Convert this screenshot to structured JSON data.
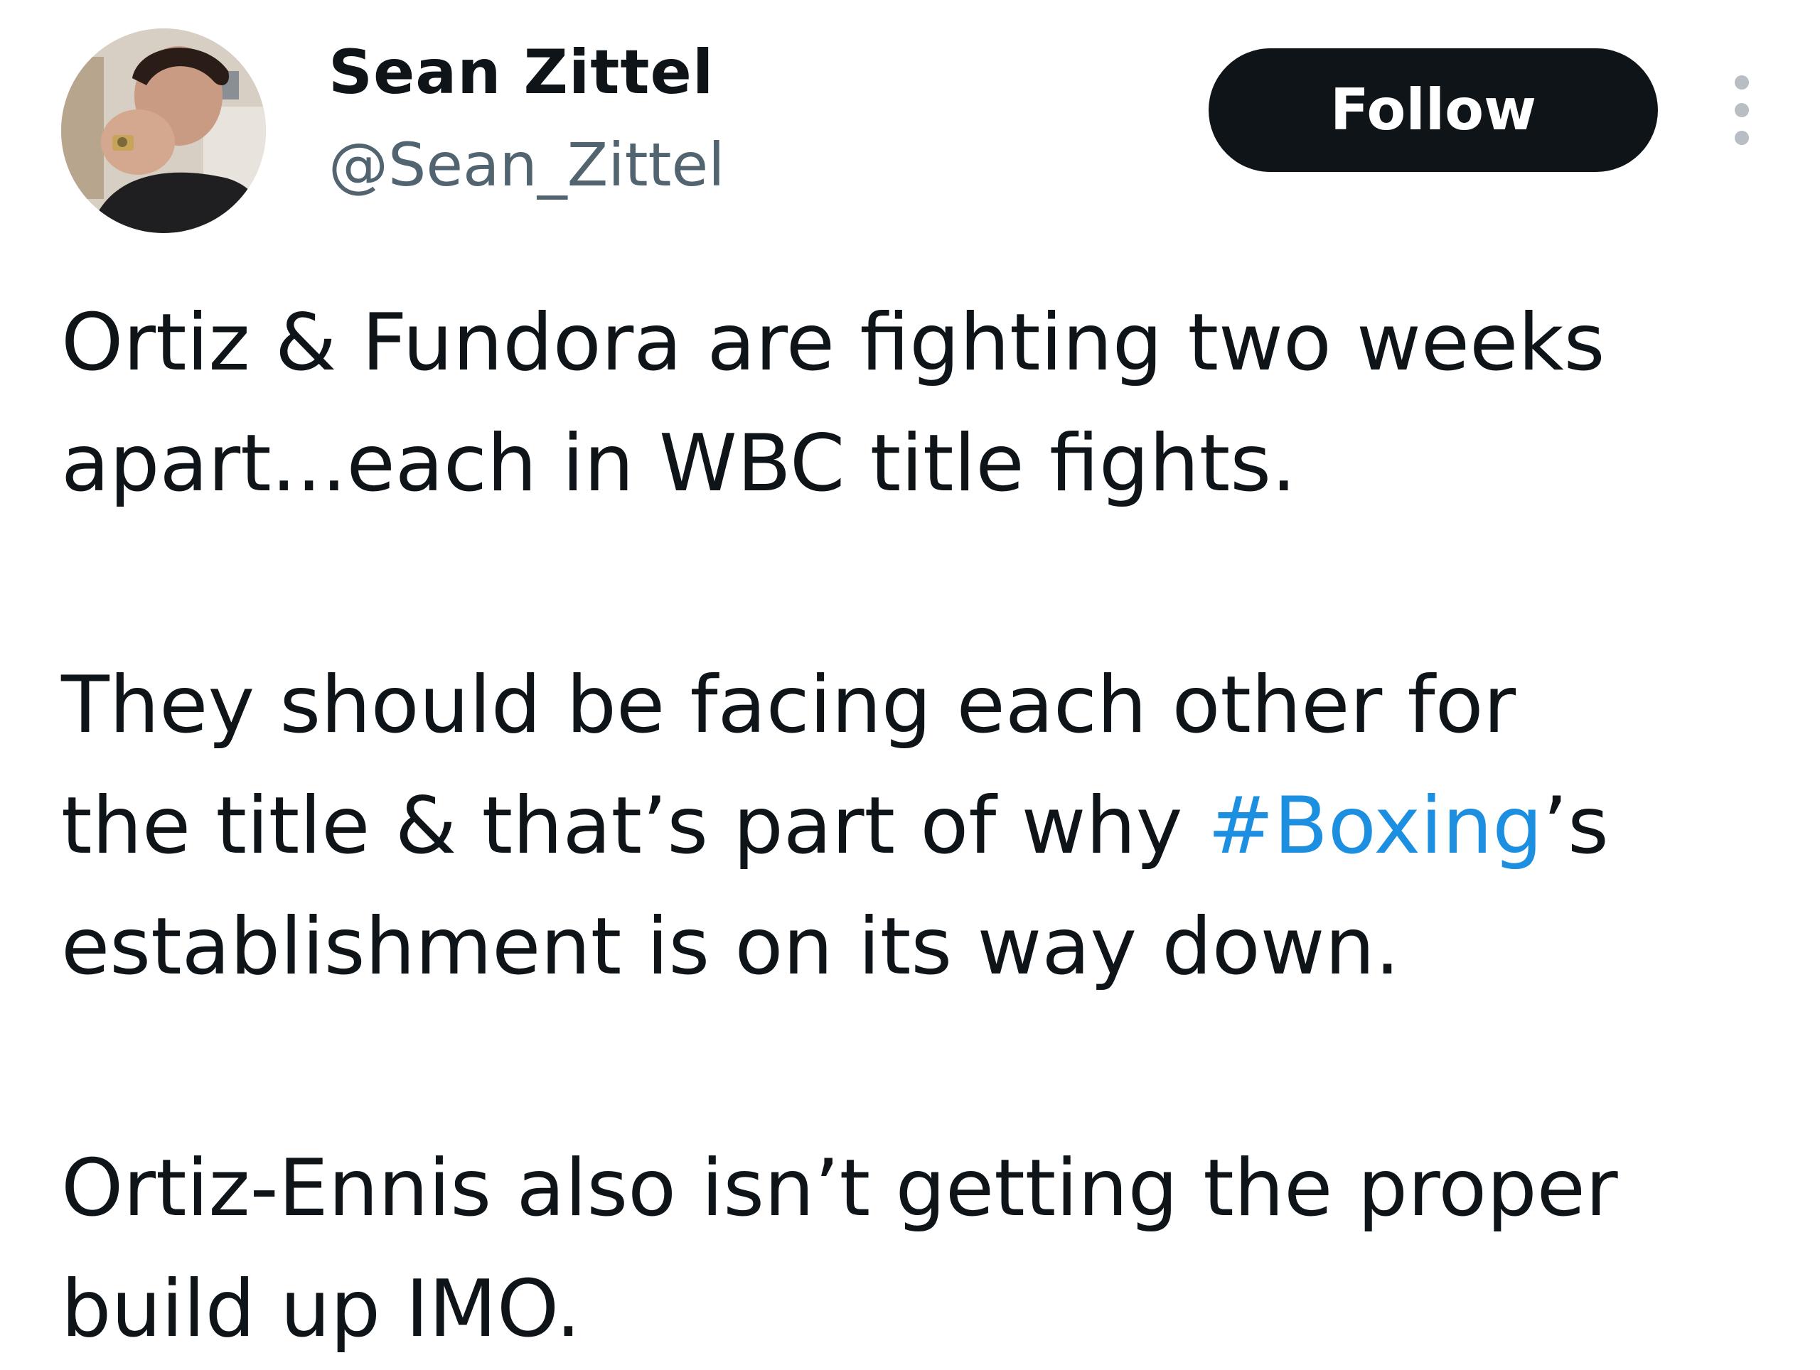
{
  "author": {
    "display_name": "Sean Zittel",
    "handle": "@Sean_Zittel"
  },
  "actions": {
    "follow_label": "Follow",
    "more_icon": "more-vertical-icon"
  },
  "tweet": {
    "paragraph1": {
      "line1": "Ortiz & Fundora are fighting two weeks",
      "line2": "apart...each in WBC title fights."
    },
    "paragraph2": {
      "line1": "They should be facing each other for",
      "line2_before": "the title & that’s part of why ",
      "hashtag": "#Boxing",
      "line2_after": "’s",
      "line3": "establishment is on its way down."
    },
    "paragraph3": {
      "line1": "Ortiz-Ennis also isn’t getting the proper",
      "line2": "build up IMO."
    }
  },
  "colors": {
    "text": "#0f1419",
    "secondary": "#536471",
    "link": "#1d8fe0",
    "button_bg": "#0f1419",
    "button_text": "#ffffff"
  }
}
